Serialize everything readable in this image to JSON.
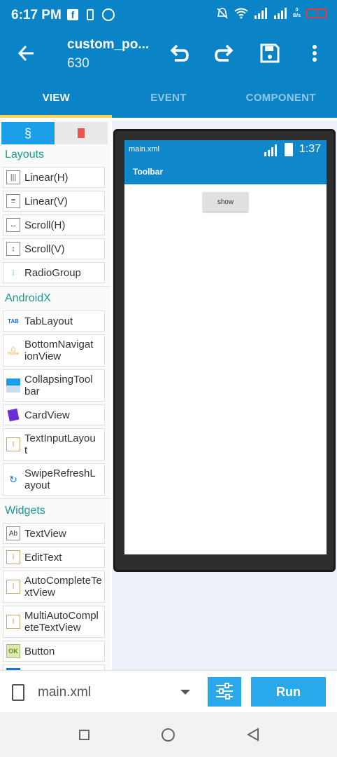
{
  "status_bar": {
    "time": "6:17 PM",
    "network_speed_value": "0",
    "network_speed_unit": "B/s",
    "battery": "5",
    "icons": [
      "facebook-icon",
      "phone-icon",
      "messenger-icon",
      "mute-icon",
      "wifi-icon",
      "signal-icon",
      "signal-icon"
    ]
  },
  "app_bar": {
    "title": "custom_po...",
    "subtitle": "630",
    "actions": [
      "undo-icon",
      "redo-icon",
      "save-icon",
      "more-vert-icon"
    ]
  },
  "tabs": [
    {
      "label": "VIEW",
      "active": true
    },
    {
      "label": "EVENT",
      "active": false
    },
    {
      "label": "COMPONENT",
      "active": false
    }
  ],
  "palette": {
    "tabs": [
      "widgets-icon",
      "bookmark-icon"
    ],
    "sections": [
      {
        "title": "Layouts",
        "items": [
          "Linear(H)",
          "Linear(V)",
          "Scroll(H)",
          "Scroll(V)",
          "RadioGroup"
        ]
      },
      {
        "title": "AndroidX",
        "items": [
          "TabLayout",
          "BottomNavigationView",
          "CollapsingToolbar",
          "CardView",
          "TextInputLayout",
          "SwipeRefreshLayout"
        ]
      },
      {
        "title": "Widgets",
        "items": [
          "TextView",
          "EditText",
          "AutoCompleteTextView",
          "MultiAutoCompleteTextView",
          "Button"
        ]
      }
    ],
    "layouts_title": "Layouts",
    "androidx_title": "AndroidX",
    "widgets_title": "Widgets",
    "layouts": {
      "linear_h": "Linear(H)",
      "linear_v": "Linear(V)",
      "scroll_h": "Scroll(H)",
      "scroll_v": "Scroll(V)",
      "radio_group": "RadioGroup"
    },
    "androidx": {
      "tab_layout": "TabLayout",
      "bottom_nav_1": "BottomNavigat",
      "bottom_nav_2": "ionView",
      "collapsing_1": "CollapsingTool",
      "collapsing_2": "bar",
      "card_view": "CardView",
      "text_input_1": "TextInputLayou",
      "text_input_2": "t",
      "swipe_1": "SwipeRefreshL",
      "swipe_2": "ayout"
    },
    "widgets": {
      "text_view": "TextView",
      "edit_text": "EditText",
      "auto_complete_1": "AutoCompleteTe",
      "auto_complete_2": "xtView",
      "multi_auto_1": "MultiAutoCompl",
      "multi_auto_2": "eteTextView",
      "button": "Button",
      "button_icon_text": "OK"
    },
    "icon_text": {
      "tab": "TAB",
      "text_view": "Ab",
      "home": "Home"
    }
  },
  "preview": {
    "file": "main.xml",
    "time": "1:37",
    "toolbar_title": "Toolbar",
    "button_label": "show",
    "colors": {
      "primary": "#1187cb"
    }
  },
  "bottom_bar": {
    "file_name": "main.xml",
    "run_label": "Run"
  },
  "colors": {
    "app_bar": "#0a84c6",
    "accent": "#29a8ec",
    "tab_indicator": "#ffd54f",
    "section_title": "#1a9a8c"
  }
}
